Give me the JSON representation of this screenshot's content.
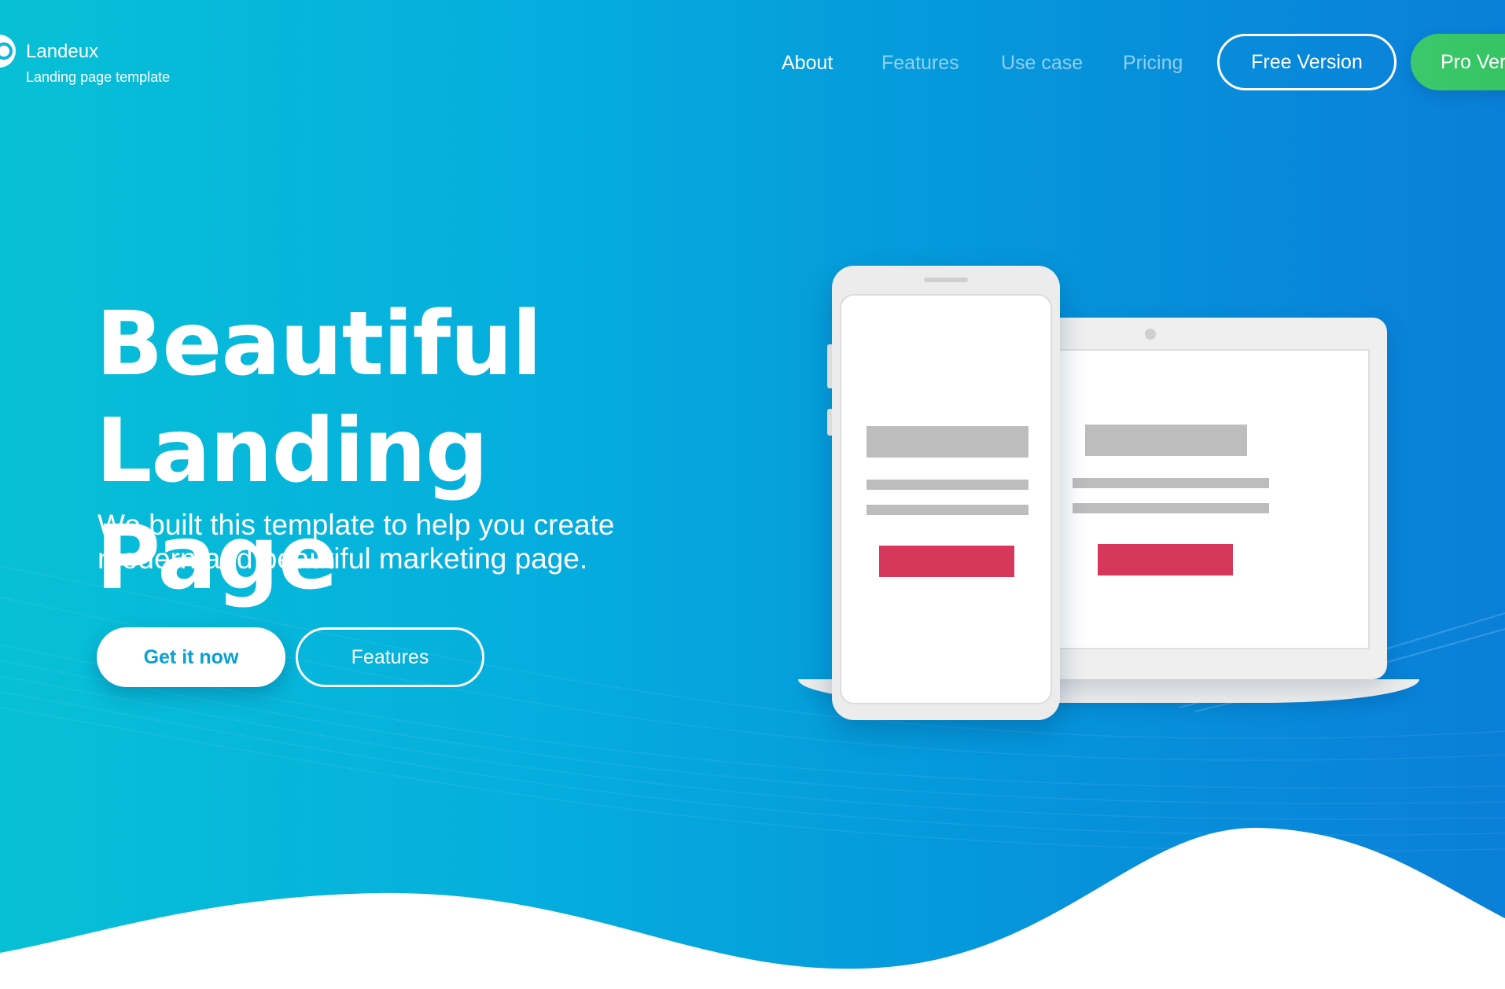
{
  "header": {
    "brand": {
      "name": "Landeux",
      "tagline": "Landing page template",
      "logo_icon": "logo-icon"
    },
    "nav": [
      {
        "label": "About",
        "active": true
      },
      {
        "label": "Features",
        "active": false
      },
      {
        "label": "Use case",
        "active": false
      },
      {
        "label": "Pricing",
        "active": false
      }
    ],
    "free_button": "Free Version",
    "pro_button": "Pro Version"
  },
  "hero": {
    "title_line1": "Beautiful",
    "title_line2": "Landing Page",
    "subtitle_line1": "We built this template to help you create",
    "subtitle_line2": "modern and beautiful marketing page.",
    "primary_button": "Get it now",
    "secondary_button": "Features"
  },
  "illustration": {
    "devices": [
      "phone-mockup",
      "laptop-mockup"
    ],
    "accent_color": "#d6375a"
  },
  "colors": {
    "gradient_start": "#08c0d6",
    "gradient_end": "#0a7fd9",
    "pro_button": "#3cc96b",
    "primary_button_text": "#0a9fd4"
  }
}
